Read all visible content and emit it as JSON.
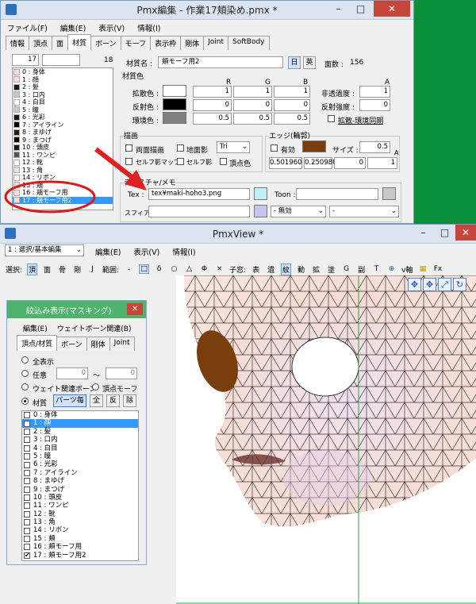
{
  "editor": {
    "title": "Pmx編集 - 作業17頬染め.pmx *",
    "menu": [
      "ファイル(F)",
      "編集(E)",
      "表示(V)",
      "情報(I)"
    ],
    "tabs": [
      "情報",
      "頂点",
      "面",
      "材質",
      "ボーン",
      "モーフ",
      "表示枠",
      "剛体",
      "Joint",
      "SoftBody"
    ],
    "active_tab": "材質",
    "list_index": "17",
    "list_count": "18",
    "materials": [
      {
        "label": "0 : 身体",
        "color": "#f7ddd5"
      },
      {
        "label": "1 : 顔",
        "color": "#f7ddd5"
      },
      {
        "label": "2 : 髪",
        "color": "#1a1a1a"
      },
      {
        "label": "3 : 口内",
        "color": "#c8c8c8"
      },
      {
        "label": "4 : 白目",
        "color": "#ffffff"
      },
      {
        "label": "5 : 瞳",
        "color": "#c8c8c8"
      },
      {
        "label": "6 : 光彩",
        "color": "#1a1a1a"
      },
      {
        "label": "7 : アイライン",
        "color": "#000000"
      },
      {
        "label": "8 : まゆげ",
        "color": "#2a1a10"
      },
      {
        "label": "9 : まつげ",
        "color": "#000000"
      },
      {
        "label": "10 : 頭皮",
        "color": "#1a1a1a"
      },
      {
        "label": "11 : ワンピ",
        "color": "#555555"
      },
      {
        "label": "12 : 靴",
        "color": "#ffffff"
      },
      {
        "label": "13 : 角",
        "color": "#e6e6e6"
      },
      {
        "label": "14 : リボン",
        "color": "#ffffff"
      },
      {
        "label": "15 : 頬",
        "color": "#f7ddd5"
      },
      {
        "label": "16 : 頬モーフ用",
        "color": "#f7ddd5"
      },
      {
        "label": "17 : 頬モーフ用2",
        "color": "#f7ddd5"
      }
    ],
    "material_name_label": "材質名 :",
    "material_name": "頬モーフ用2",
    "lang_jp": "日",
    "lang_en": "英",
    "face_count_label": "面数 :",
    "face_count": "156",
    "color_section": "材質色",
    "rgba_headers": [
      "R",
      "G",
      "B",
      "A"
    ],
    "diffuse_label": "拡散色 :",
    "diffuse": [
      "1",
      "1",
      "1"
    ],
    "specular_label": "反射色 :",
    "specular": [
      "0",
      "0",
      "0"
    ],
    "ambient_label": "環境色 :",
    "ambient": [
      "0.5",
      "0.5",
      "0.5"
    ],
    "alpha_label": "非透過度 :",
    "alpha": "1",
    "power_label": "反射強度 :",
    "power": "0",
    "sync_label": "拡散-環境同期",
    "draw_section": "描画",
    "double_side": "両面描画",
    "ground_shadow": "地面影",
    "draw_mode": "Tri",
    "self_shadow_map": "セルフ影マップ",
    "self_shadow": "セルフ影",
    "vertex_color": "頂点色",
    "edge_section": "エッジ(輪郭)",
    "edge_enable": "有効",
    "edge_size_label": "サイズ :",
    "edge_size": "0.5",
    "edge_color": [
      "0.501960",
      "0.250980",
      "0",
      "1"
    ],
    "texture_section": "テクスチャ/メモ",
    "tex_label": "Tex :",
    "tex_value": "tex¥maki-hoho3.png",
    "toon_label": "Toon :",
    "sphere_label": "スフィア :",
    "sphere_mode": "- 無効"
  },
  "view": {
    "title": "PmxView *",
    "mode_select": "1 : 選択/基本編集",
    "menu": [
      "編集(E)",
      "表示(V)",
      "情報(I)"
    ],
    "toolbar": [
      "選択:",
      "頂",
      "面",
      "骨",
      "剛",
      "J",
      "範囲:",
      "・",
      "□",
      "δ",
      "○",
      "△",
      "Φ",
      "×",
      "子窓:",
      "表",
      "遺",
      "紋",
      "動",
      "拡",
      "塗",
      "G",
      "副",
      "T",
      "v軸",
      "Fx"
    ]
  },
  "mask": {
    "title": "絞込み表示(マスキング)",
    "menu": [
      "編集(E)",
      "ウェイトボーン関連(B)"
    ],
    "tabs": [
      "頂点/材質",
      "ボーン",
      "剛体",
      "Joint"
    ],
    "opt_all": "全表示",
    "opt_any": "任意",
    "range_from": "0",
    "range_to": "0",
    "opt_weight": "ウェイト関連ボーン",
    "opt_vmorph": "頂点モーフ",
    "opt_material": "材質",
    "btn_parts": "パーツ毎",
    "btn_all": "全",
    "btn_inv": "反",
    "btn_del": "除",
    "items": [
      {
        "label": "0 : 身体",
        "checked": false
      },
      {
        "label": "1 : 顔",
        "checked": true
      },
      {
        "label": "2 : 髪",
        "checked": false
      },
      {
        "label": "3 : 口内",
        "checked": false
      },
      {
        "label": "4 : 白目",
        "checked": false
      },
      {
        "label": "5 : 瞳",
        "checked": false
      },
      {
        "label": "6 : 光彩",
        "checked": false
      },
      {
        "label": "7 : アイライン",
        "checked": false
      },
      {
        "label": "8 : まゆげ",
        "checked": false
      },
      {
        "label": "9 : まつげ",
        "checked": false
      },
      {
        "label": "10 : 頭皮",
        "checked": false
      },
      {
        "label": "11 : ワンピ",
        "checked": false
      },
      {
        "label": "12 : 靴",
        "checked": false
      },
      {
        "label": "13 : 角",
        "checked": false
      },
      {
        "label": "14 : リボン",
        "checked": false
      },
      {
        "label": "15 : 頬",
        "checked": false
      },
      {
        "label": "16 : 頬モーフ用",
        "checked": false
      },
      {
        "label": "17 : 頬モーフ用2",
        "checked": true
      }
    ]
  },
  "colors": {
    "selection": "#3399ff",
    "edge_swatch": "#7a3d0c",
    "arrow": "#e02020",
    "circle": "#d61d1d",
    "mask_title": "#4fb36b"
  }
}
